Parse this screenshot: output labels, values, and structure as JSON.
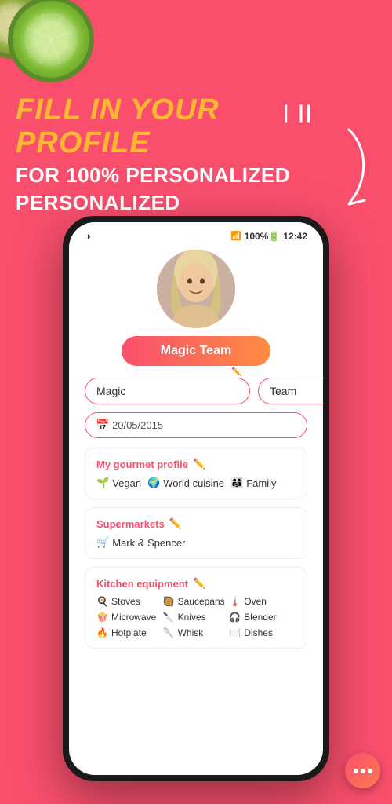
{
  "background_color": "#F94F6D",
  "cucumber": {
    "label": "cucumber-decoration"
  },
  "headline": {
    "fill": "FILL IN YOUR PROFILE",
    "sub_line1": "FOR 100% PERSONALIZED",
    "sub_line2": "PERSONALIZED"
  },
  "status_bar": {
    "signal": "📶",
    "battery": "100%🔋",
    "time": "12:42",
    "left_icon": "◑"
  },
  "profile": {
    "button_label": "Magic Team",
    "first_name": "Magic",
    "last_name": "Team",
    "first_name_placeholder": "Magic",
    "last_name_placeholder": "Team",
    "date": "20/05/2015",
    "date_placeholder": "20/05/2015"
  },
  "gourmet_card": {
    "title": "My gourmet profile",
    "items": [
      {
        "icon": "🌱",
        "label": "Vegan"
      },
      {
        "icon": "🌍",
        "label": "World cuisine"
      },
      {
        "icon": "👨‍👩‍👧",
        "label": "Family"
      }
    ]
  },
  "supermarkets_card": {
    "title": "Supermarkets",
    "items": [
      {
        "icon": "🛒",
        "label": "Mark & Spencer"
      }
    ]
  },
  "kitchen_card": {
    "title": "Kitchen equipment",
    "items": [
      {
        "icon": "🍳",
        "label": "Stoves"
      },
      {
        "icon": "🥘",
        "label": "Saucepans"
      },
      {
        "icon": "🌡️",
        "label": "Oven"
      },
      {
        "icon": "🍿",
        "label": "Microwave"
      },
      {
        "icon": "🔪",
        "label": "Knives"
      },
      {
        "icon": "🎧",
        "label": "Blender"
      },
      {
        "icon": "🔥",
        "label": "Hotplate"
      },
      {
        "icon": "🥄",
        "label": "Whisk"
      },
      {
        "icon": "🍽️",
        "label": "Dishes"
      }
    ]
  },
  "chat_bubble": {
    "label": "chat-button"
  }
}
